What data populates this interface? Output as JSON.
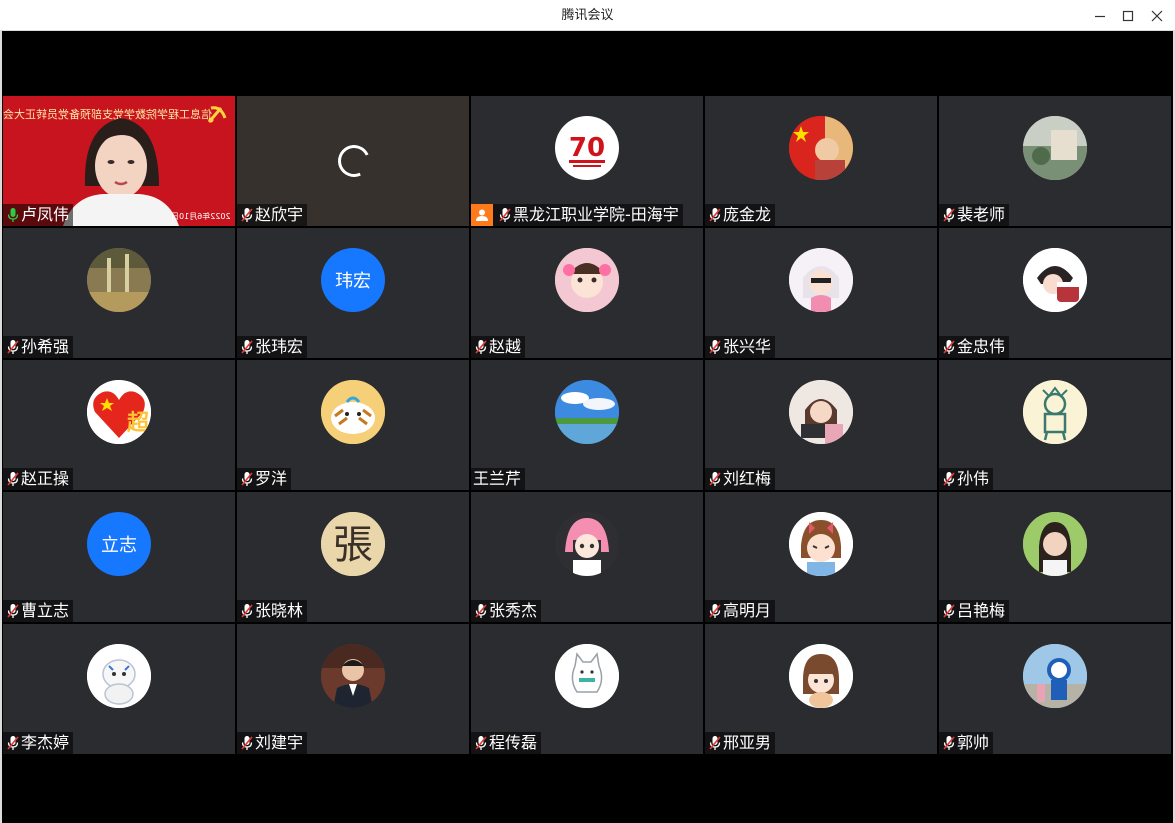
{
  "window": {
    "title": "腾讯会议"
  },
  "video_tile": {
    "banner": "信息工程学院数学党支部预备党员转正大会",
    "datestamp": "2022年6月10日"
  },
  "participants": [
    {
      "name": "卢凤伟",
      "mic": "on",
      "avatar": "video"
    },
    {
      "name": "赵欣宇",
      "mic": "off",
      "avatar": "loading"
    },
    {
      "name": "黑龙江职业学院-田海宇",
      "mic": "off",
      "avatar": "70th-anniversary-logo",
      "host": true
    },
    {
      "name": "庞金龙",
      "mic": "off",
      "avatar": "flag-girl-photo"
    },
    {
      "name": "裴老师",
      "mic": "off",
      "avatar": "landscape-photo"
    },
    {
      "name": "孙希强",
      "mic": "off",
      "avatar": "street-photo"
    },
    {
      "name": "张玮宏",
      "mic": "off",
      "avatar": "text",
      "avatar_text": "玮宏"
    },
    {
      "name": "赵越",
      "mic": "off",
      "avatar": "child-photo"
    },
    {
      "name": "张兴华",
      "mic": "off",
      "avatar": "cartoon-girl"
    },
    {
      "name": "金忠伟",
      "mic": "off",
      "avatar": "anime-boy"
    },
    {
      "name": "赵正操",
      "mic": "off",
      "avatar": "flag-heart"
    },
    {
      "name": "罗洋",
      "mic": "off",
      "avatar": "tiger-cartoon"
    },
    {
      "name": "王兰芹",
      "mic": "none",
      "avatar": "sky-photo"
    },
    {
      "name": "刘红梅",
      "mic": "off",
      "avatar": "cartoon-laptop-girl"
    },
    {
      "name": "孙伟",
      "mic": "off",
      "avatar": "cartoon-figure"
    },
    {
      "name": "曹立志",
      "mic": "off",
      "avatar": "text",
      "avatar_text": "立志"
    },
    {
      "name": "张晓林",
      "mic": "off",
      "avatar": "calligraphy-zhang"
    },
    {
      "name": "张秀杰",
      "mic": "off",
      "avatar": "pink-hair-cartoon"
    },
    {
      "name": "高明月",
      "mic": "off",
      "avatar": "cartoon-girl-bow"
    },
    {
      "name": "吕艳梅",
      "mic": "off",
      "avatar": "woman-photo"
    },
    {
      "name": "李杰婷",
      "mic": "off",
      "avatar": "white-tiger-cartoon"
    },
    {
      "name": "刘建宇",
      "mic": "off",
      "avatar": "man-suit-photo"
    },
    {
      "name": "程传磊",
      "mic": "off",
      "avatar": "white-cat-cartoon"
    },
    {
      "name": "邢亚男",
      "mic": "off",
      "avatar": "cartoon-girl-bangs"
    },
    {
      "name": "郭帅",
      "mic": "off",
      "avatar": "mascot-photo"
    }
  ],
  "colors": {
    "tile_bg": "#2b2c2f",
    "active_border": "#2ecc40",
    "mic_muted": "#e53935",
    "mic_on": "#2ecc40",
    "text_avatar": "#1677ff",
    "host_badge": "#ff7a1a"
  }
}
